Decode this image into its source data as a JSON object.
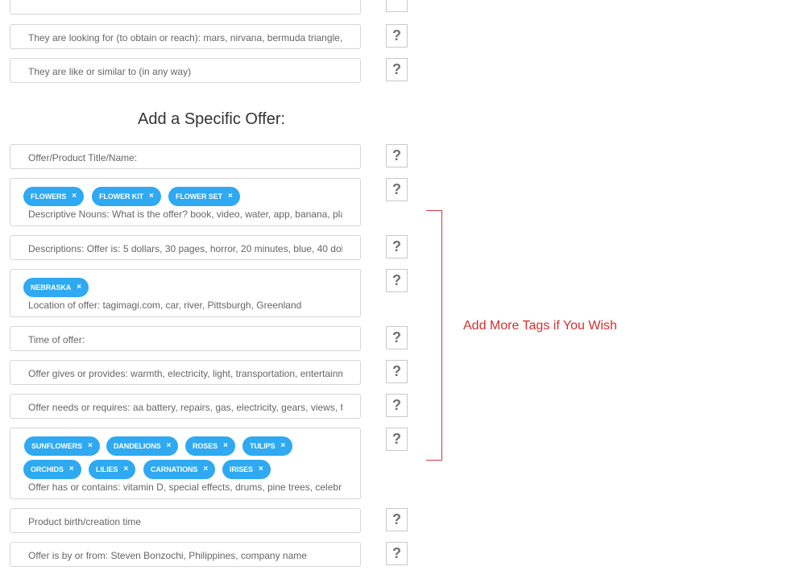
{
  "fields_top": [
    {
      "placeholder": "They are looking for (to obtain or reach): mars, nirvana, bermuda triangle,"
    },
    {
      "placeholder": "They are like or similar to (in any way)"
    }
  ],
  "section_title": "Add a Specific Offer:",
  "fields": {
    "title_name": "Offer/Product Title/Name:",
    "nouns": "Descriptive Nouns: What is the offer? book, video, water, app, banana, pla",
    "descriptions": "Descriptions: Offer is: 5 dollars, 30 pages, horror, 20 minutes, blue, 40 dol",
    "location": "Location of offer: tagimagi.com, car, river, Pittsburgh, Greenland",
    "time": "Time of offer:",
    "gives": "Offer gives or provides: warmth, electricity, light, transportation, entertainm",
    "needs": "Offer needs or requires: aa battery, repairs, gas, electricity, gears, views, f",
    "contains": "Offer has or contains: vitamin D, special effects, drums, pine trees, celebri",
    "birth": "Product birth/creation time",
    "by_from": "Offer is by or from: Steven Bonzochi, Philippines, company name"
  },
  "tags": {
    "nouns": [
      "FLOWERS",
      "FLOWER KIT",
      "FLOWER SET"
    ],
    "location": [
      "NEBRASKA"
    ],
    "contains_row1": [
      "SUNFLOWERS",
      "DANDELIONS",
      "ROSES",
      "TULIPS"
    ],
    "contains_row2": [
      "ORCHIDS",
      "LILIES",
      "CARNATIONS",
      "IRISES"
    ]
  },
  "tag_remove_symbol": "×",
  "help_symbol": "?",
  "annotation": "Add More Tags if You Wish",
  "colors": {
    "tag_bg": "#2ea9f2",
    "annotation": "#d32f2f"
  }
}
